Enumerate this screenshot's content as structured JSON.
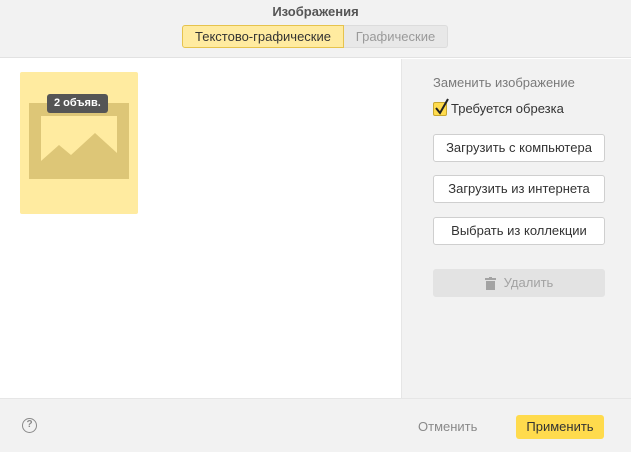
{
  "header": {
    "title": "Изображения",
    "tabs": [
      {
        "label": "Текстово-графические",
        "active": true
      },
      {
        "label": "Графические",
        "active": false
      }
    ]
  },
  "canvas": {
    "card": {
      "badge": "2 объяв.",
      "icon": "image-placeholder-icon"
    }
  },
  "panel": {
    "title": "Заменить изображение",
    "crop_label": "Требуется обрезка",
    "crop_checked": true,
    "upload_pc": "Загрузить с компьютера",
    "upload_web": "Загрузить из интернета",
    "collection": "Выбрать из коллекции",
    "delete": "Удалить"
  },
  "footer": {
    "help": "?",
    "cancel": "Отменить",
    "apply": "Применить"
  },
  "colors": {
    "accent": "#ffdb4d",
    "card_bg": "#ffeba0",
    "panel_bg": "#f2f2f2"
  }
}
